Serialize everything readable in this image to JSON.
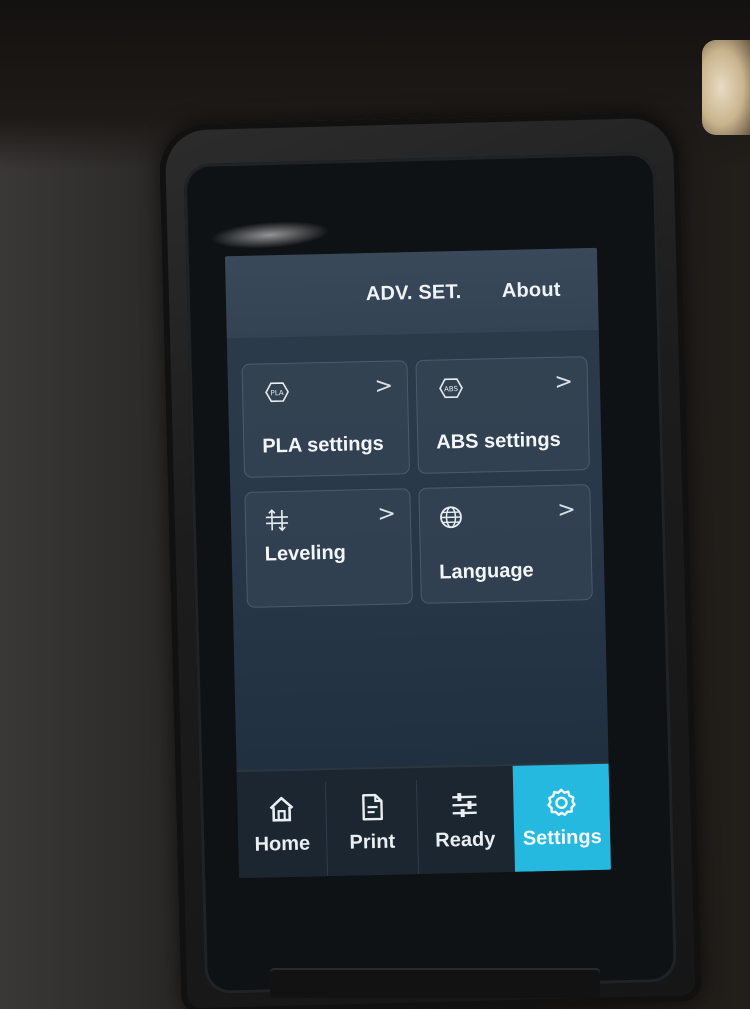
{
  "top_tabs": {
    "adv_set": "ADV. SET.",
    "about": "About"
  },
  "tiles": [
    {
      "label": "PLA settings",
      "icon": "pla-badge-icon",
      "icon_text": "PLA",
      "chevron": ">"
    },
    {
      "label": "ABS settings",
      "icon": "abs-badge-icon",
      "icon_text": "ABS",
      "chevron": ">"
    },
    {
      "label": "Leveling",
      "icon": "leveling-arrows-icon",
      "chevron": ">"
    },
    {
      "label": "Language",
      "icon": "globe-icon",
      "chevron": ">"
    }
  ],
  "nav": {
    "items": [
      {
        "label": "Home",
        "icon": "home-icon"
      },
      {
        "label": "Print",
        "icon": "file-icon"
      },
      {
        "label": "Ready",
        "icon": "sliders-icon"
      },
      {
        "label": "Settings",
        "icon": "gear-icon",
        "active": true
      }
    ]
  },
  "colors": {
    "active_tab": "#26b9df",
    "screen_bg": "#29394a",
    "nav_bg": "#1c2630"
  }
}
